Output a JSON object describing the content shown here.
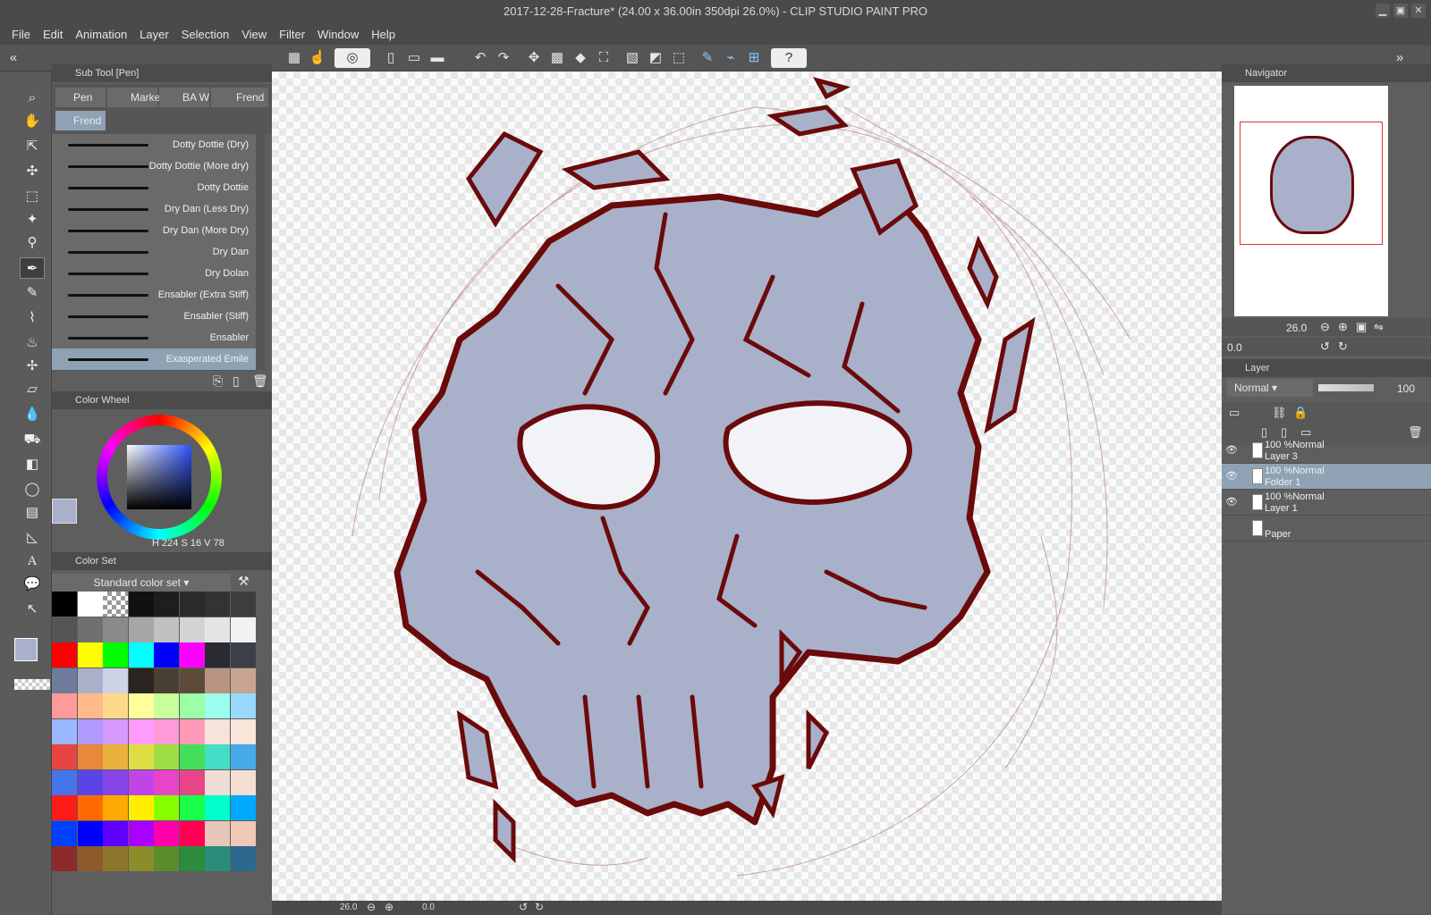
{
  "window": {
    "title": "2017-12-28-Fracture* (24.00 x 36.00in 350dpi 26.0%)  - CLIP STUDIO PAINT PRO"
  },
  "menu": [
    "File",
    "Edit",
    "Animation",
    "Layer",
    "Selection",
    "View",
    "Filter",
    "Window",
    "Help"
  ],
  "subtool": {
    "panel_title": "Sub Tool [Pen]",
    "tabs": [
      "Pen",
      "Marke",
      "BA W",
      "Frend",
      "Frend"
    ],
    "brushes": [
      "Dotty Dottie (Dry)",
      "Dotty Dottie (More dry)",
      "Dotty Dottie",
      "Dry Dan (Less Dry)",
      "Dry Dan (More Dry)",
      "Dry Dan",
      "Dry Dolan",
      "Ensabler (Extra Stiff)",
      "Ensabler (Stiff)",
      "Ensabler",
      "Exasperated Emile"
    ],
    "selected_brush": "Exasperated Emile"
  },
  "color_wheel": {
    "title": "Color Wheel",
    "h_label": "H",
    "h": "224",
    "s_label": "S",
    "s": "16",
    "v_label": "V",
    "v": "78",
    "main_color": "#a8b1c9",
    "sub_color": "#0010ff"
  },
  "color_set": {
    "title": "Color Set",
    "set_name": "Standard color set",
    "rows": [
      [
        "#000000",
        "#ffffff",
        "checker",
        "#111111",
        "#1e1e1e",
        "#2a2a2a",
        "#333333",
        "#3d3d3d"
      ],
      [
        "#555555",
        "#707070",
        "#8a8a8a",
        "#a6a6a6",
        "#c0c0c0",
        "#d3d3d3",
        "#e4e4e4",
        "#f2f2f2"
      ],
      [
        "#ff0000",
        "#ffff00",
        "#00ff00",
        "#00ffff",
        "#0000ff",
        "#ff00ff",
        "#2a2a33",
        "#3c3f4a"
      ],
      [
        "#6e7b9a",
        "#a9b0c8",
        "#cfd3e6",
        "#2a2520",
        "#4a3f33",
        "#5c4b3a",
        "#b89583",
        "#c7a591"
      ],
      [
        "#ff9a9a",
        "#ffb98a",
        "#ffd98a",
        "#ffff9a",
        "#c8ff9a",
        "#9affa6",
        "#9affee",
        "#9ad9ff"
      ],
      [
        "#9ab8ff",
        "#b09aff",
        "#d69aff",
        "#ff9aff",
        "#ff9ad8",
        "#ff9ab8",
        "#f7e3dc",
        "#fbe6dc"
      ],
      [
        "#e84444",
        "#e8883c",
        "#e8b23c",
        "#dede44",
        "#9ede44",
        "#44de5a",
        "#44dec6",
        "#44aae8"
      ],
      [
        "#4474e8",
        "#5a44e8",
        "#8844e8",
        "#c044e8",
        "#e844c8",
        "#e84488",
        "#f0dcd6",
        "#f4ddd2"
      ],
      [
        "#ff1a1a",
        "#ff6a00",
        "#ffaa00",
        "#ffee00",
        "#88ff00",
        "#1aff4a",
        "#00ffcc",
        "#00aaff"
      ],
      [
        "#0040ff",
        "#0000ff",
        "#6000ff",
        "#aa00ff",
        "#ff00aa",
        "#ff0055",
        "#e8c6bb",
        "#f0c8b6"
      ],
      [
        "#8c2b2b",
        "#8c5a2b",
        "#8c762b",
        "#8c8c2b",
        "#5a8c2b",
        "#2b8c3e",
        "#2b8c7a",
        "#2b6a8c"
      ]
    ]
  },
  "navigator": {
    "title": "Navigator",
    "zoom": "26.0",
    "angle": "0.0"
  },
  "layer_panel": {
    "title": "Layer",
    "blend": "Normal",
    "opacity": "100",
    "layers": [
      {
        "mode": "100 %Normal",
        "name": "Layer 3"
      },
      {
        "mode": "100 %Normal",
        "name": "Folder 1"
      },
      {
        "mode": "100 %Normal",
        "name": "Layer 1"
      },
      {
        "mode": "",
        "name": "Paper"
      }
    ]
  },
  "status": {
    "zoom": "26.0",
    "angle": "0.0"
  },
  "colors": {
    "fill": "#a8b1c9",
    "ink": "#6a0a0a"
  }
}
